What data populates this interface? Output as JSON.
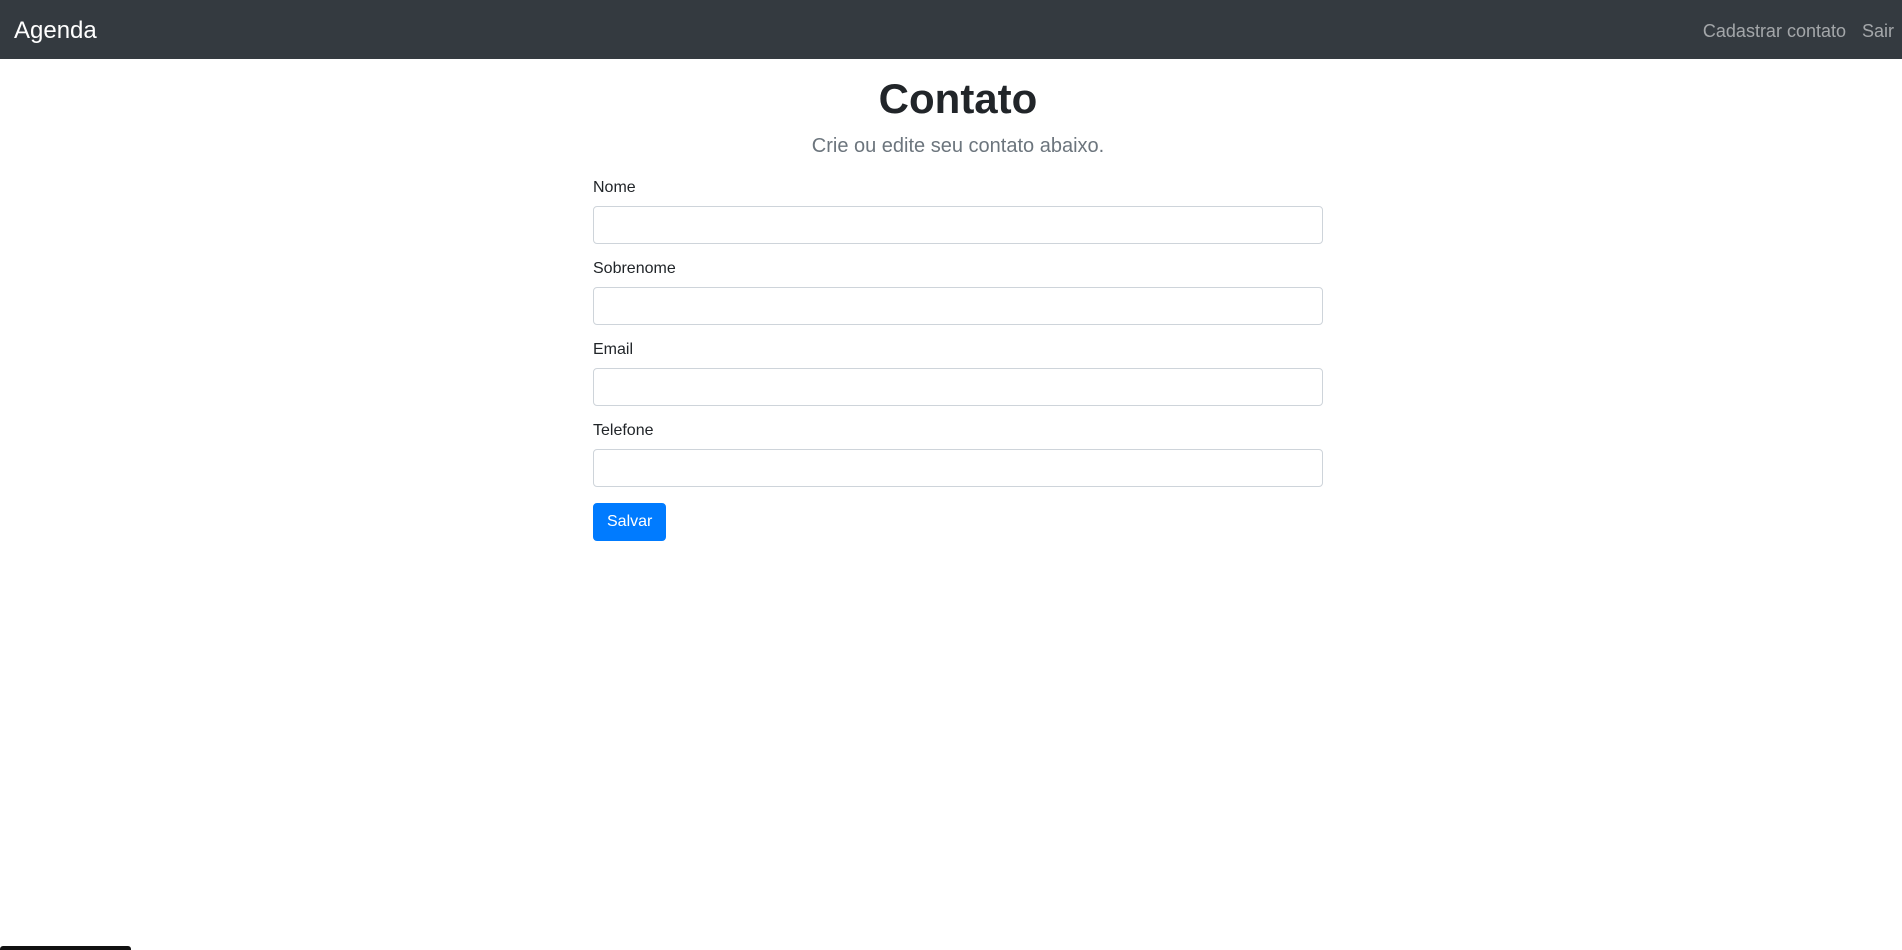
{
  "navbar": {
    "brand": "Agenda",
    "links": [
      {
        "label": "Cadastrar contato"
      },
      {
        "label": "Sair"
      }
    ],
    "background": "#343a40"
  },
  "page": {
    "title": "Contato",
    "lead": "Crie ou edite seu contato abaixo."
  },
  "form": {
    "fields": [
      {
        "label": "Nome",
        "value": ""
      },
      {
        "label": "Sobrenome",
        "value": ""
      },
      {
        "label": "Email",
        "value": ""
      },
      {
        "label": "Telefone",
        "value": ""
      }
    ],
    "submit_label": "Salvar",
    "accent": "#007bff"
  }
}
